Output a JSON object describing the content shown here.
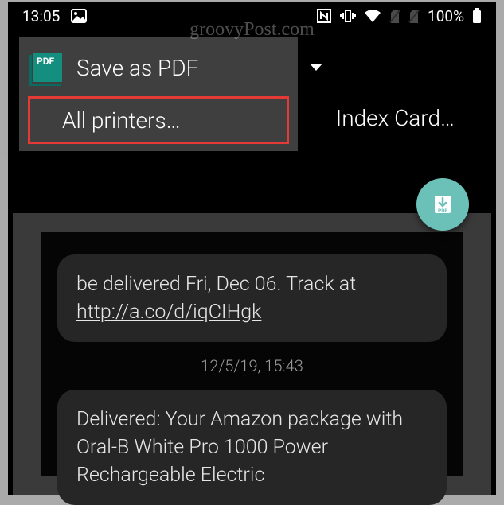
{
  "status": {
    "time": "13:05",
    "battery": "100%"
  },
  "dropdown": {
    "save_as_pdf": "Save as PDF",
    "all_printers": "All printers…"
  },
  "header": {
    "paper": "Index Card…"
  },
  "preview": {
    "msg1_prefix": "be delivered Fri, Dec 06. Track at ",
    "msg1_link": "http://a.co/d/iqCIHgk",
    "timestamp": "12/5/19, 15:43",
    "msg2": "Delivered: Your Amazon package with Oral-B White Pro 1000 Power Rechargeable Electric"
  },
  "watermark": "groovyPost.com"
}
